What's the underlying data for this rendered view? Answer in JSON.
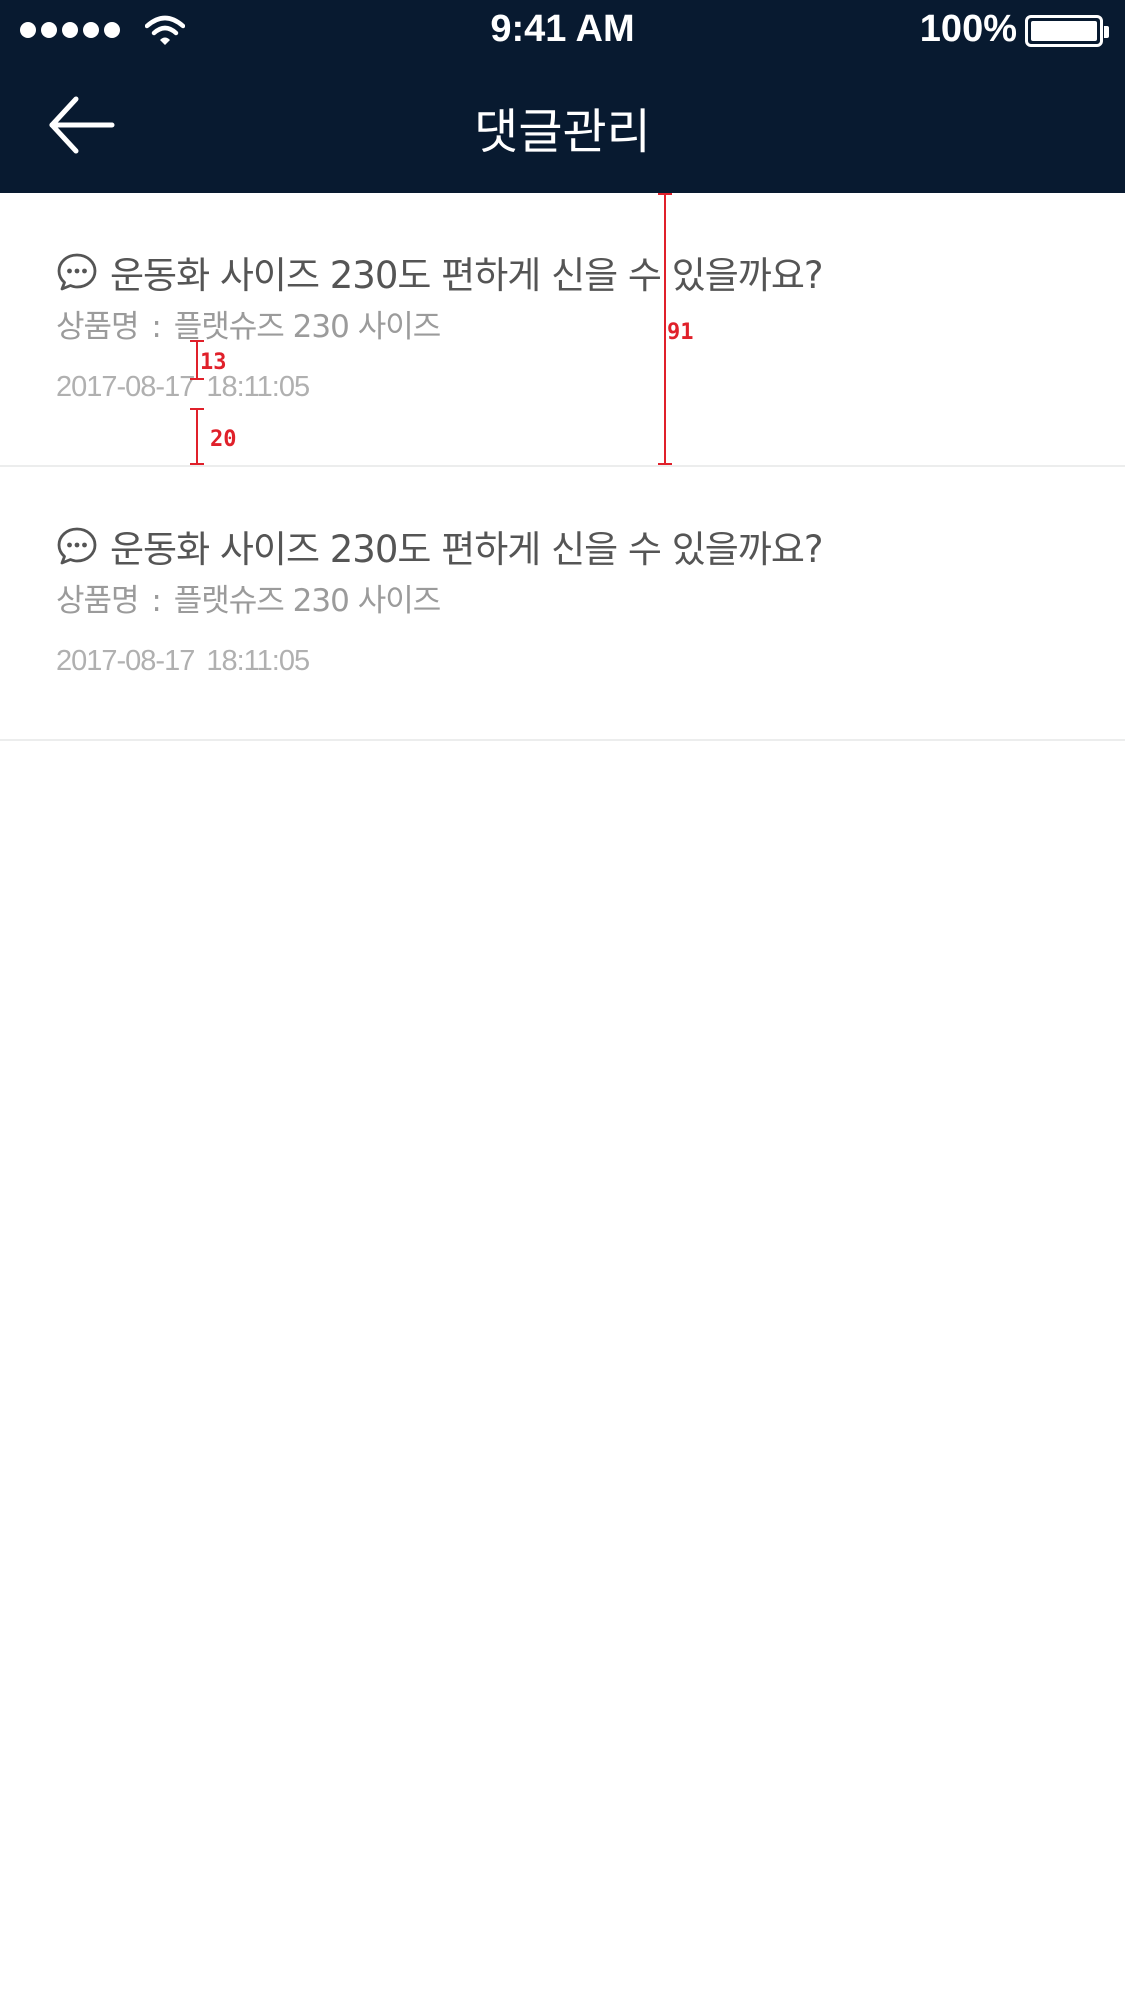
{
  "status_bar": {
    "time": "9:41 AM",
    "battery_percent": "100%",
    "signal_bars": 5,
    "icons": [
      "signal-dots-icon",
      "wifi-icon",
      "battery-icon"
    ]
  },
  "nav": {
    "title": "댓글관리",
    "back_icon": "back-arrow-icon"
  },
  "comments": [
    {
      "icon": "speech-bubble-icon",
      "question": "운동화 사이즈 230도 편하게 신을 수 있을까요?",
      "product_label": "상품명",
      "product_sep": ":",
      "product_name": "플랫슈즈 230 사이즈",
      "date": "2017-08-17",
      "time": "18:11:05"
    },
    {
      "icon": "speech-bubble-icon",
      "question": "운동화 사이즈 230도 편하게 신을 수 있을까요?",
      "product_label": "상품명",
      "product_sep": ":",
      "product_name": "플랫슈즈 230 사이즈",
      "date": "2017-08-17",
      "time": "18:11:05"
    }
  ],
  "annotations": {
    "item_height": "91",
    "gap_product_to_date": "13",
    "bottom_padding": "20"
  },
  "colors": {
    "header_bg": "#081a30",
    "title_text": "#555555",
    "product_text": "#9b9b9b",
    "date_text": "#b0b0b0",
    "divider": "#eceded",
    "annotation": "#e0202a"
  }
}
